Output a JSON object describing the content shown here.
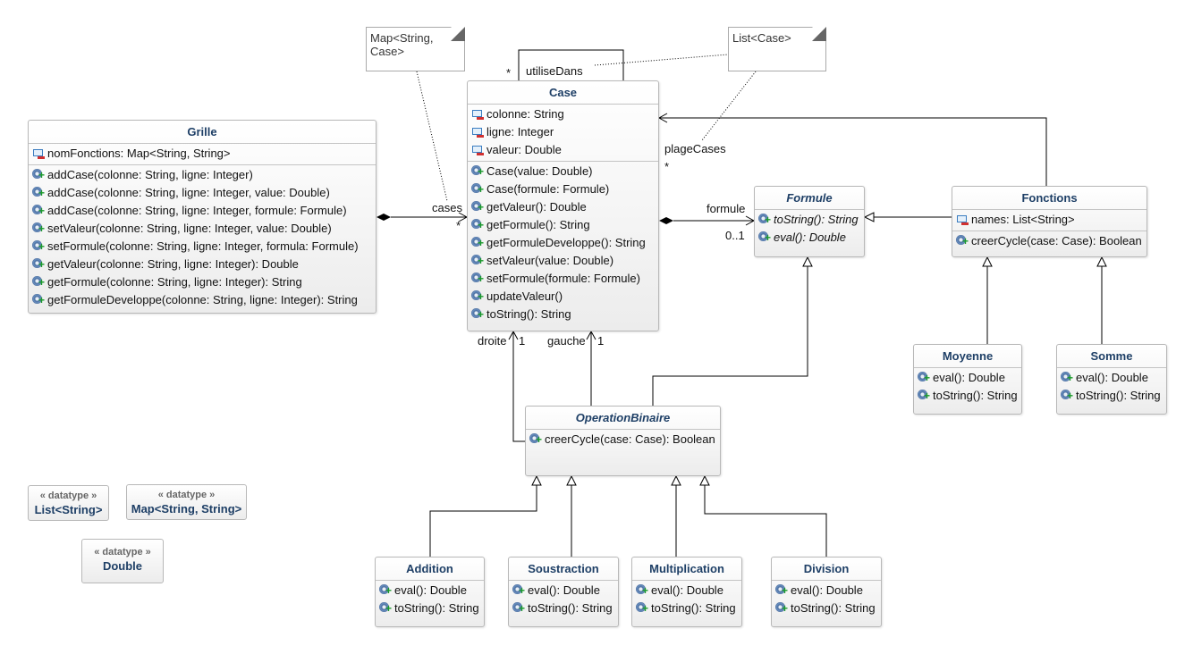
{
  "classes": [
    {
      "id": "grille",
      "name": "Grille",
      "abstract": false,
      "attributes": [
        "nomFonctions: Map<String, String>"
      ],
      "methods": [
        "addCase(colonne: String, ligne: Integer)",
        "addCase(colonne: String, ligne: Integer, value: Double)",
        "addCase(colonne: String, ligne: Integer, formule: Formule)",
        "setValeur(colonne: String, ligne: Integer, value: Double)",
        "setFormule(colonne: String, ligne: Integer, formula: Formule)",
        "getValeur(colonne: String, ligne: Integer): Double",
        "getFormule(colonne: String, ligne: Integer): String",
        "getFormuleDeveloppe(colonne: String, ligne: Integer): String"
      ]
    },
    {
      "id": "case",
      "name": "Case",
      "abstract": false,
      "attributes": [
        "colonne: String",
        "ligne: Integer",
        "valeur: Double"
      ],
      "methods": [
        "Case(value: Double)",
        "Case(formule: Formule)",
        "getValeur(): Double",
        "getFormule(): String",
        "getFormuleDeveloppe(): String",
        "setValeur(value: Double)",
        "setFormule(formule: Formule)",
        "updateValeur()",
        "toString(): String"
      ]
    },
    {
      "id": "formule",
      "name": "Formule",
      "abstract": true,
      "attributes": [],
      "methods": [
        "toString(): String",
        "eval(): Double"
      ]
    },
    {
      "id": "fonctions",
      "name": "Fonctions",
      "abstract": false,
      "attributes": [
        "names: List<String>"
      ],
      "methods": [
        "creerCycle(case: Case): Boolean"
      ]
    },
    {
      "id": "moyenne",
      "name": "Moyenne",
      "abstract": false,
      "attributes": [],
      "methods": [
        "eval(): Double",
        "toString(): String"
      ]
    },
    {
      "id": "somme",
      "name": "Somme",
      "abstract": false,
      "attributes": [],
      "methods": [
        "eval(): Double",
        "toString(): String"
      ]
    },
    {
      "id": "operationbinaire",
      "name": "OperationBinaire",
      "abstract": true,
      "attributes": [],
      "methods": [
        "creerCycle(case: Case): Boolean"
      ]
    },
    {
      "id": "addition",
      "name": "Addition",
      "abstract": false,
      "attributes": [],
      "methods": [
        "eval(): Double",
        "toString(): String"
      ]
    },
    {
      "id": "soustraction",
      "name": "Soustraction",
      "abstract": false,
      "attributes": [],
      "methods": [
        "eval(): Double",
        "toString(): String"
      ]
    },
    {
      "id": "multiplication",
      "name": "Multiplication",
      "abstract": false,
      "attributes": [],
      "methods": [
        "eval(): Double",
        "toString(): String"
      ]
    },
    {
      "id": "division",
      "name": "Division",
      "abstract": false,
      "attributes": [],
      "methods": [
        "eval(): Double",
        "toString(): String"
      ]
    }
  ],
  "datatypes": [
    {
      "stereotype": "« datatype »",
      "name": "List<String>"
    },
    {
      "stereotype": "« datatype »",
      "name": "Map<String, String>"
    },
    {
      "stereotype": "« datatype »",
      "name": "Double"
    }
  ],
  "notes": [
    {
      "text": "Map<String, Case>"
    },
    {
      "text": "List<Case>"
    }
  ],
  "labels": {
    "utiliseDans": "utiliseDans",
    "utiliseDans_mult": "*",
    "cases": "cases",
    "cases_mult": "*",
    "formule": "formule",
    "formule_mult": "0..1",
    "plageCases": "plageCases",
    "plageCases_mult": "*",
    "droite": "droite",
    "droite_mult": "1",
    "gauche": "gauche",
    "gauche_mult": "1"
  },
  "colors": {
    "class_name": "#1e3f66",
    "border": "#b8b8b8",
    "line": "#000000"
  }
}
